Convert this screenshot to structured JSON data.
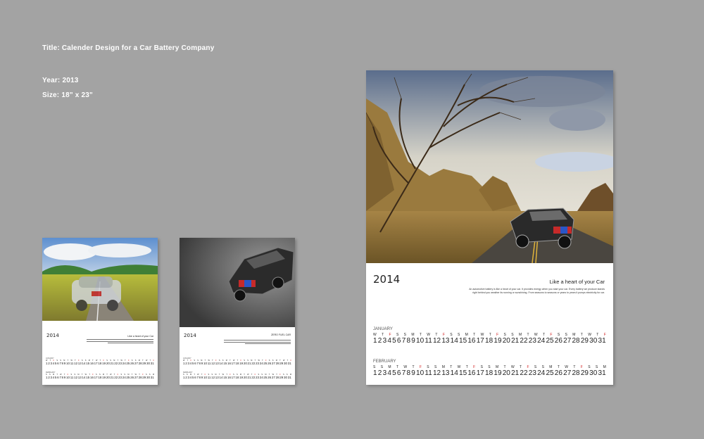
{
  "meta": {
    "title": "Title: Calender Design for a Car Battery Company",
    "year": "Year: 2013",
    "size": "Size: 18\" x 23\""
  },
  "calendar": {
    "year": "2014",
    "tagline_large": "Like a heart of your Car",
    "blurb_large": "An automotive battery is like a heart of your car. It provides energy when you start your car. Every battery we produce stands  right behind you weather its running or sunshining.  From seasons to seasons or years to years it pumps electricity for car.",
    "tagline_small1": "Like a heart of your Car",
    "tagline_small2": "ZERO FUEL CAR",
    "january": {
      "name": "JANUARY",
      "weekdays": [
        "W",
        "T",
        "F",
        "S",
        "S",
        "M",
        "T",
        "W",
        "T",
        "F",
        "S",
        "S",
        "M",
        "T",
        "W",
        "T",
        "F",
        "S",
        "S",
        "M",
        "T",
        "W",
        "T",
        "F",
        "S",
        "S",
        "M",
        "T",
        "W",
        "T",
        "F"
      ],
      "days": [
        "1",
        "2",
        "3",
        "4",
        "5",
        "6",
        "7",
        "8",
        "9",
        "10",
        "11",
        "12",
        "13",
        "14",
        "15",
        "16",
        "17",
        "18",
        "19",
        "20",
        "21",
        "22",
        "23",
        "24",
        "25",
        "26",
        "27",
        "28",
        "29",
        "30",
        "31"
      ]
    },
    "february": {
      "name": "FEBRUARY",
      "weekdays": [
        "S",
        "S",
        "M",
        "T",
        "W",
        "T",
        "F",
        "S",
        "S",
        "M",
        "T",
        "W",
        "T",
        "F",
        "S",
        "S",
        "M",
        "T",
        "W",
        "T",
        "F",
        "S",
        "S",
        "M",
        "T",
        "W",
        "T",
        "F",
        "S",
        "S",
        "M"
      ],
      "days": [
        "1",
        "2",
        "3",
        "4",
        "5",
        "6",
        "7",
        "8",
        "9",
        "10",
        "11",
        "12",
        "13",
        "14",
        "15",
        "16",
        "17",
        "18",
        "19",
        "20",
        "21",
        "22",
        "23",
        "24",
        "25",
        "26",
        "27",
        "28",
        "29",
        "30",
        "31"
      ]
    }
  },
  "colors": {
    "background": "#a3a3a3",
    "sunday_red": "#d32020"
  }
}
